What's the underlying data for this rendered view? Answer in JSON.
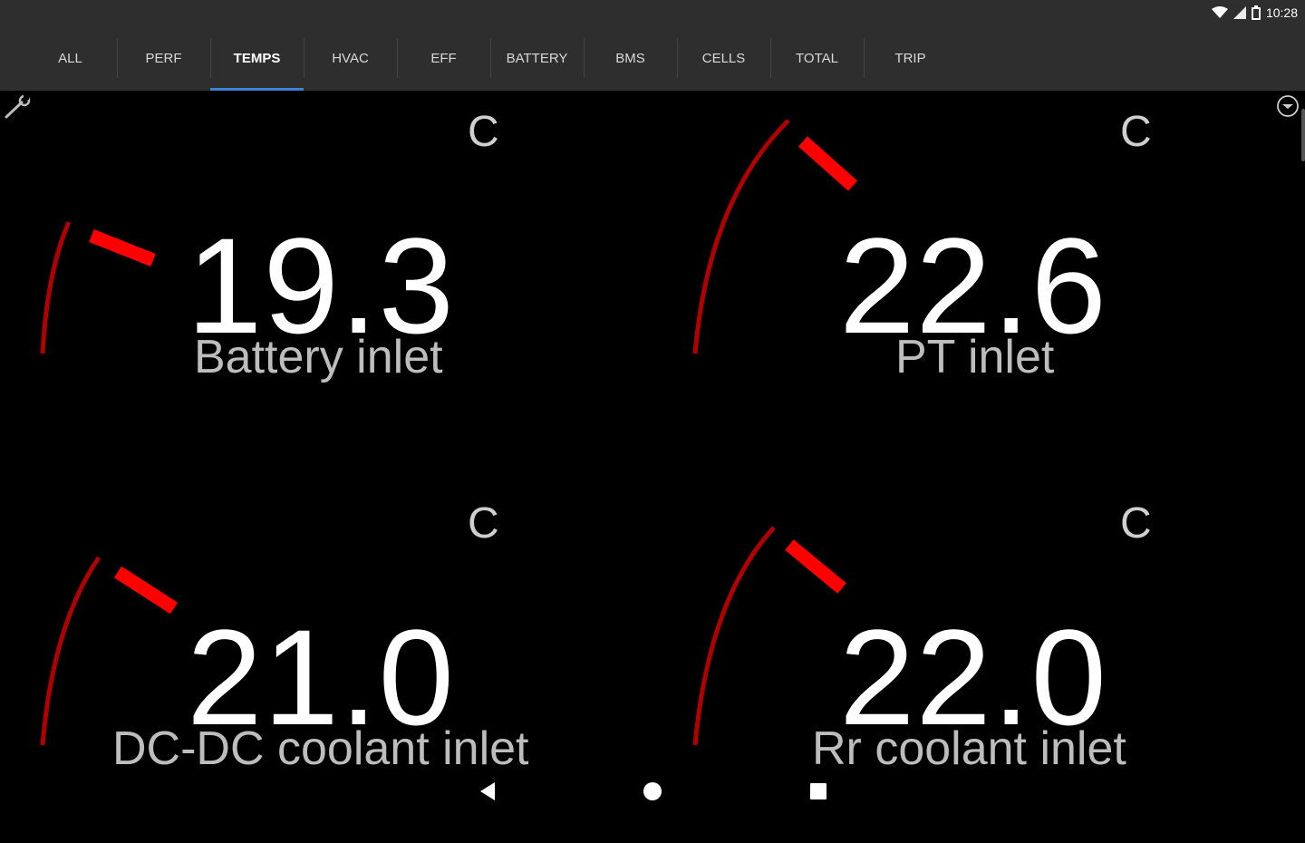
{
  "status_bar": {
    "time": "10:28",
    "icons": [
      "wifi-icon",
      "cell-signal-icon",
      "battery-icon"
    ]
  },
  "tabs": [
    {
      "label": "ALL",
      "active": false
    },
    {
      "label": "PERF",
      "active": false
    },
    {
      "label": "TEMPS",
      "active": true
    },
    {
      "label": "HVAC",
      "active": false
    },
    {
      "label": "EFF",
      "active": false
    },
    {
      "label": "BATTERY",
      "active": false
    },
    {
      "label": "BMS",
      "active": false
    },
    {
      "label": "CELLS",
      "active": false
    },
    {
      "label": "TOTAL",
      "active": false
    },
    {
      "label": "TRIP",
      "active": false
    }
  ],
  "toolbar": {
    "settings_icon": "wrench-icon",
    "menu_icon": "chevron-down-circle-icon"
  },
  "gauges": [
    {
      "value": "19.3",
      "unit": "C",
      "label": "Battery inlet"
    },
    {
      "value": "22.6",
      "unit": "C",
      "label": "PT inlet"
    },
    {
      "value": "21.0",
      "unit": "C",
      "label": "DC-DC coolant inlet"
    },
    {
      "value": "22.0",
      "unit": "C",
      "label": "Rr coolant inlet"
    }
  ],
  "colors": {
    "arc": "#b00000",
    "needle": "#ff0000",
    "tab_indicator": "#3a83d6",
    "background": "#000000",
    "bar": "#2e2e2e"
  },
  "navbar": {
    "icons": [
      "back-icon",
      "home-icon",
      "recent-apps-icon"
    ]
  }
}
